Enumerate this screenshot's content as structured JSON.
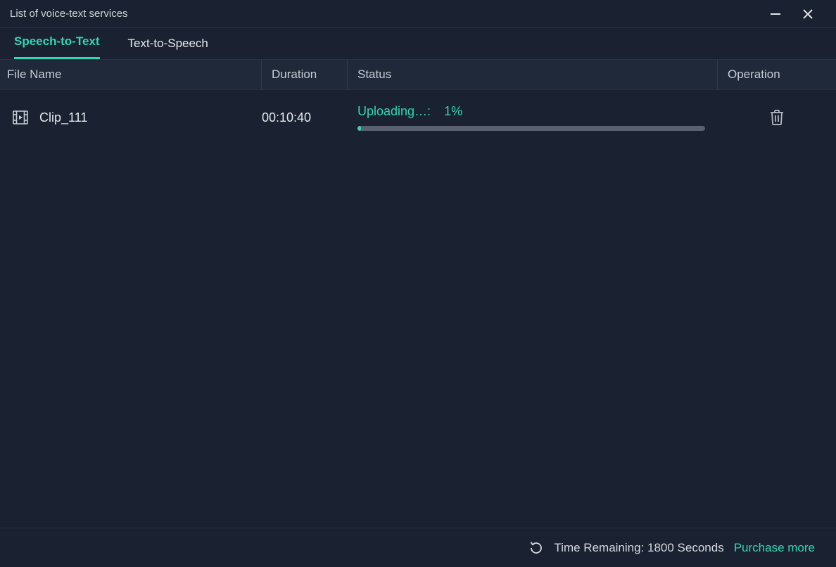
{
  "window": {
    "title": "List of voice-text services"
  },
  "tabs": {
    "stt": "Speech-to-Text",
    "tts": "Text-to-Speech"
  },
  "columns": {
    "filename": "File Name",
    "duration": "Duration",
    "status": "Status",
    "operation": "Operation"
  },
  "rows": [
    {
      "filename": "Clip_111",
      "duration": "00:10:40",
      "status_label": "Uploading…:",
      "percent_text": "1%",
      "percent_value": 1
    }
  ],
  "footer": {
    "time_remaining": "Time Remaining: 1800 Seconds",
    "purchase": "Purchase more"
  }
}
